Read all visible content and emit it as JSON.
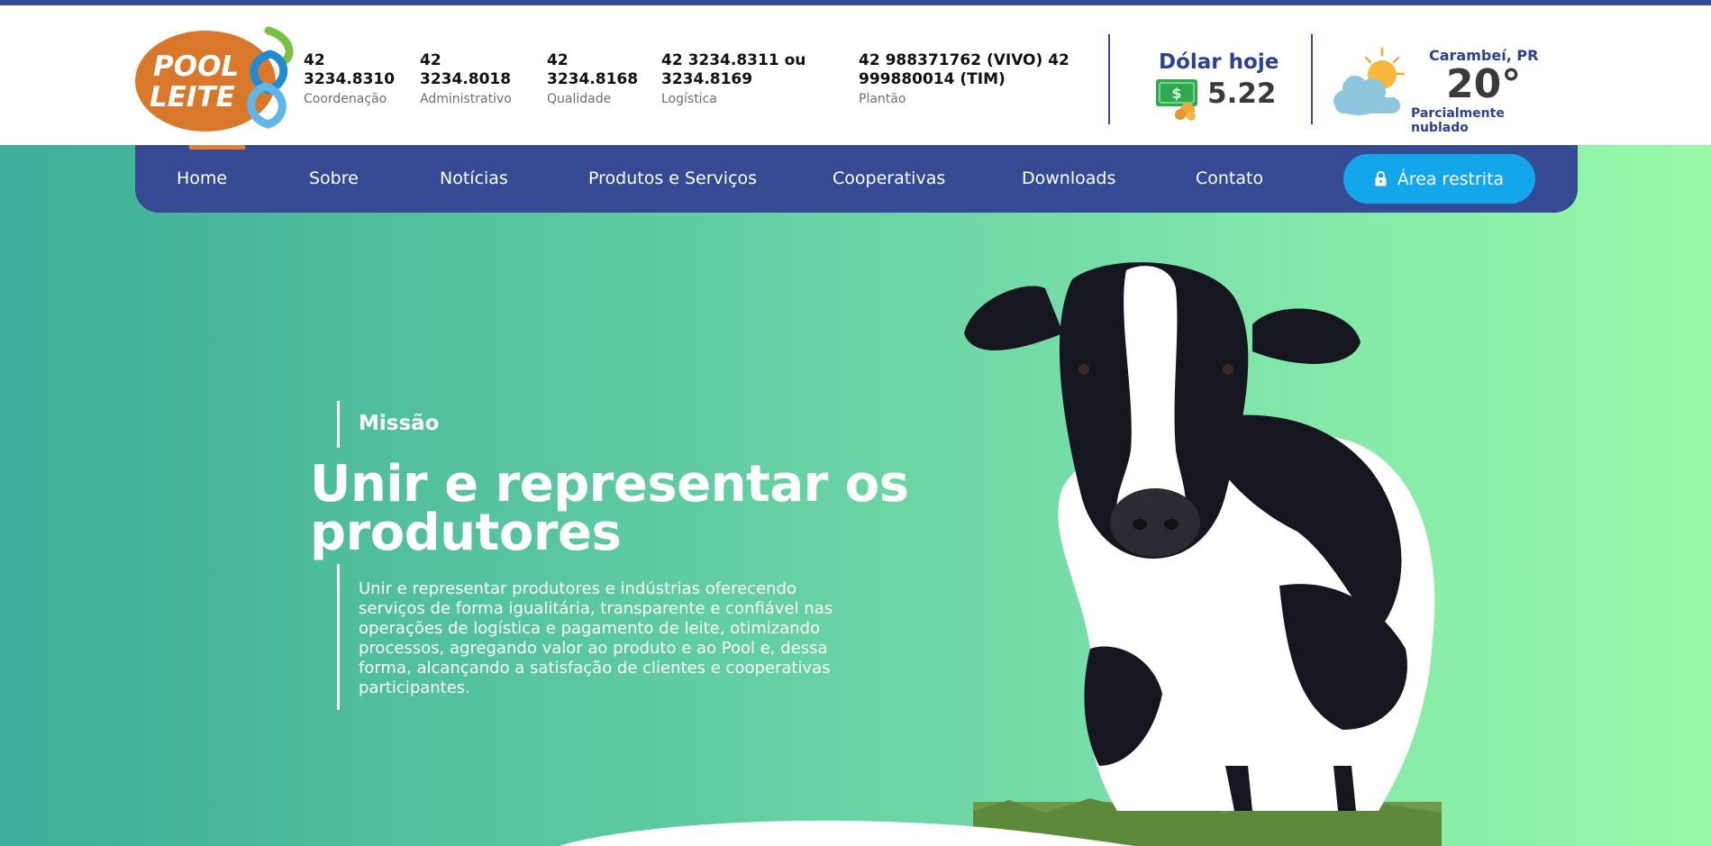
{
  "brand": {
    "logo_line1": "POOL",
    "logo_line2": "LEITE"
  },
  "contacts": [
    {
      "number": "42 3234.8310",
      "label": "Coordenação"
    },
    {
      "number": "42 3234.8018",
      "label": "Administrativo"
    },
    {
      "number": "42 3234.8168",
      "label": "Qualidade"
    },
    {
      "number": "42 3234.8311 ou 3234.8169",
      "label": "Logística"
    },
    {
      "number": "42 988371762 (VIVO) 42 999880014 (TIM)",
      "label": "Plantão"
    }
  ],
  "dollar": {
    "title": "Dólar hoje",
    "value": "5.22"
  },
  "weather": {
    "city": "Carambeí, PR",
    "temp": "20°",
    "desc": "Parcialmente nublado",
    "icon": "partly-cloudy-icon"
  },
  "nav": {
    "items": [
      "Home",
      "Sobre",
      "Notícias",
      "Produtos e Serviços",
      "Cooperativas",
      "Downloads",
      "Contato"
    ],
    "active": "Home",
    "restricted_label": "Área restrita"
  },
  "hero": {
    "label": "Missão",
    "title": "Unir e representar os produtores",
    "text": "Unir e representar produtores e indústrias oferecendo serviços de forma igualitária, transparente e confiável nas operações de logística e pagamento de leite, otimizando processos, agregando valor ao produto e ao Pool e, dessa forma, alcançando a satisfação de clientes e cooperativas participantes."
  },
  "colors": {
    "brand_blue": "#354a93",
    "accent_orange": "#e0803a",
    "button_blue": "#14a6ea",
    "hero_gradient_start": "#3fad98",
    "hero_gradient_end": "#98f9a8"
  }
}
